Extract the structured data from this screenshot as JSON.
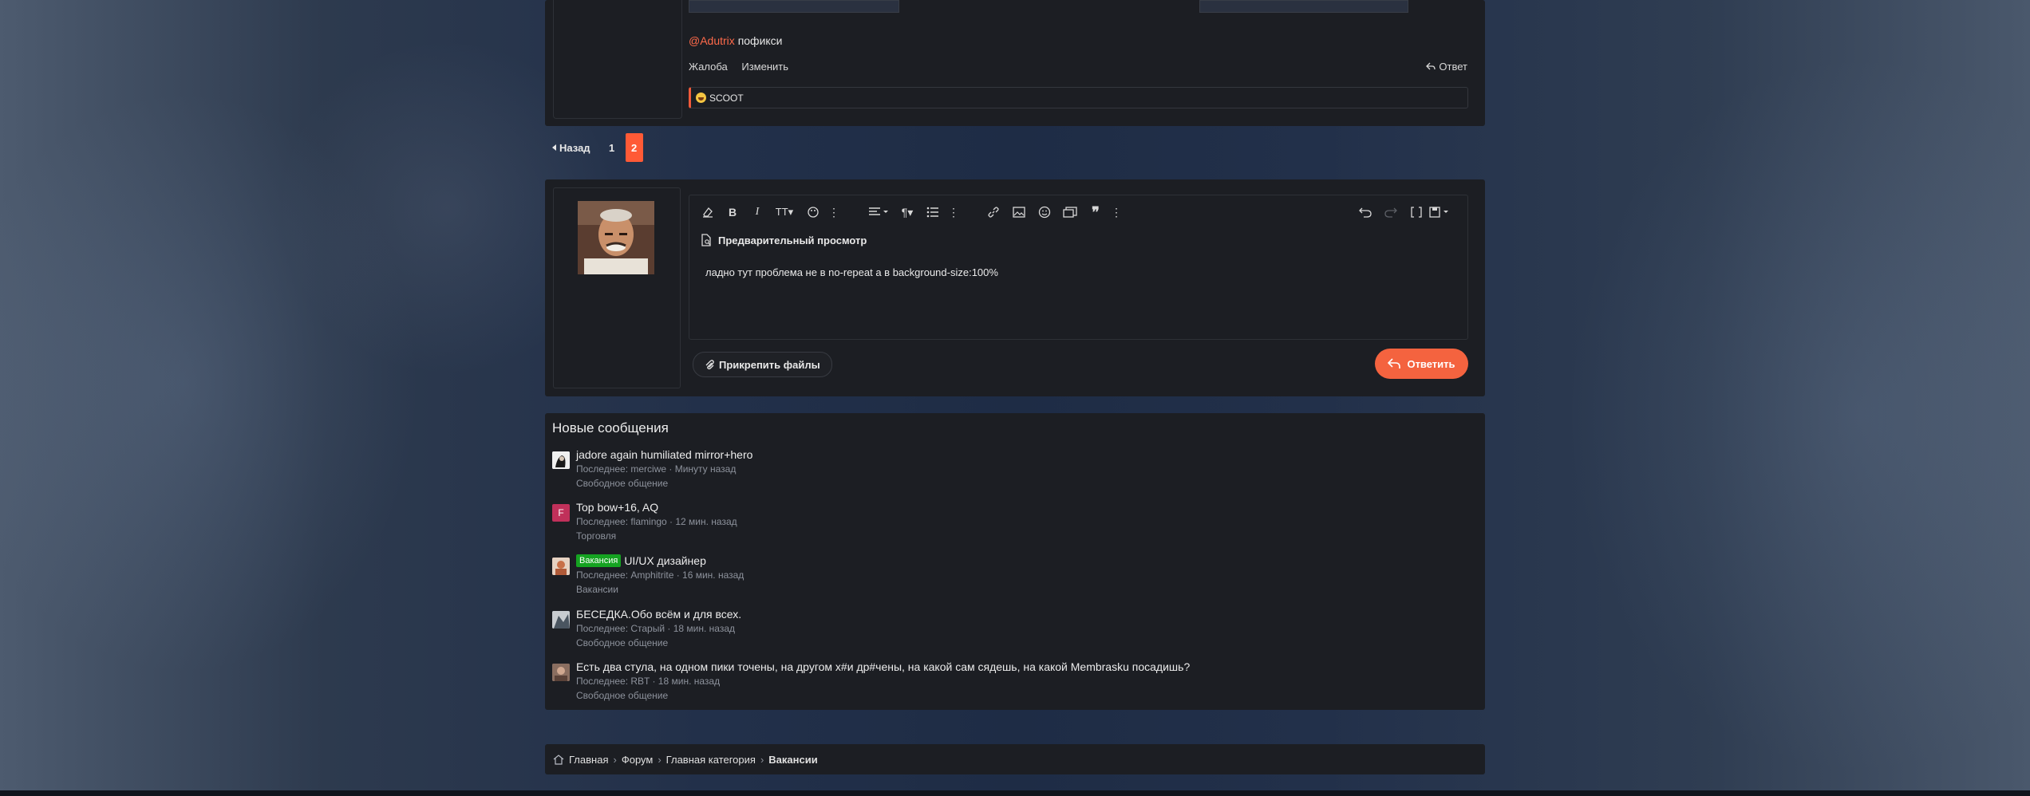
{
  "previous_post": {
    "mention": "@Adutrix",
    "text": "пофикси",
    "actions": [
      "Жалоба",
      "Изменить"
    ],
    "reply_label": "Ответ",
    "reactions_text": "SCOOT"
  },
  "pagination": {
    "prev_label": "Назад",
    "pages": [
      "1",
      "2"
    ],
    "current_page": "2"
  },
  "reply": {
    "preview_label": "Предварительный просмотр",
    "editor_text": "ладно тут проблема не в no-repeat а в background-size:100%",
    "attach_label": "Прикрепить файлы",
    "submit_label": "Ответить"
  },
  "new_messages": {
    "title": "Новые сообщения",
    "items": [
      {
        "title": "jadore again humiliated mirror+hero",
        "meta": "Последнее: merciwe · Минуту назад",
        "forum": "Свободное общение",
        "badge": "",
        "avatar_letter": "",
        "avatar_color": "#e0e0e0"
      },
      {
        "title": "Top bow+16, AQ",
        "meta": "Последнее: flamingo · 12 мин. назад",
        "forum": "Торговля",
        "badge": "",
        "avatar_letter": "F",
        "avatar_color": "#c0305a"
      },
      {
        "title": "UI/UX дизайнер",
        "meta": "Последнее: Amphitrite · 16 мин. назад",
        "forum": "Вакансии",
        "badge": "Вакансия",
        "avatar_letter": "",
        "avatar_color": "#c8704a"
      },
      {
        "title": "БЕСЕДКА.Обо всём и для всех.",
        "meta": "Последнее: Старый · 18 мин. назад",
        "forum": "Свободное общение",
        "badge": "",
        "avatar_letter": "",
        "avatar_color": "#7a8a9a"
      },
      {
        "title": "Есть два стула, на одном пики точены, на другом х#и др#чены, на какой сам сядешь, на какой Membrasku посадишь?",
        "meta": "Последнее: RBT · 18 мин. назад",
        "forum": "Свободное общение",
        "badge": "",
        "avatar_letter": "",
        "avatar_color": "#9a7a6a"
      }
    ]
  },
  "breadcrumb": [
    "Главная",
    "Форум",
    "Главная категория",
    "Вакансии"
  ],
  "colors": {
    "accent": "#f4633f",
    "mention": "#ff6a4a",
    "badge": "#15a321",
    "panel": "#1c1e23"
  }
}
